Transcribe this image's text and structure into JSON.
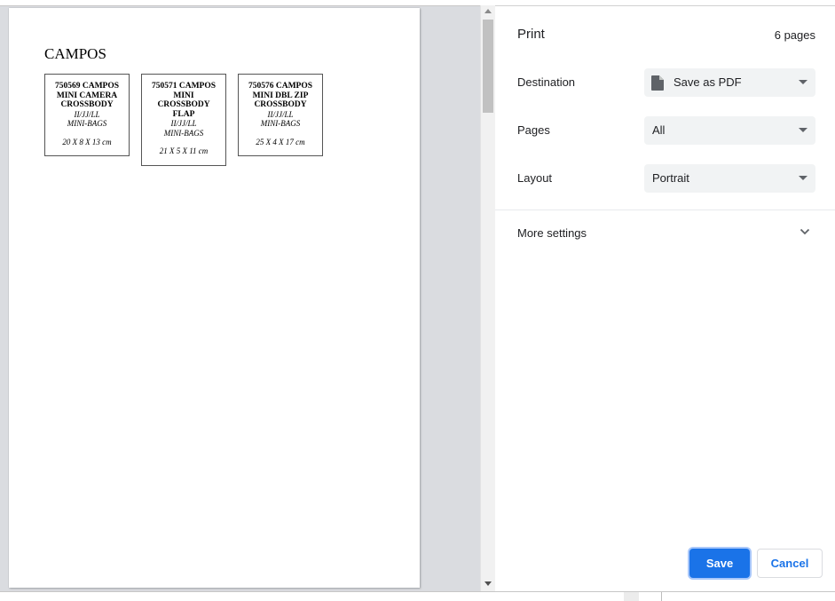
{
  "preview": {
    "heading": "CAMPOS",
    "cards": [
      {
        "title": "750569 CAMPOS\nMINI CAMERA\nCROSSBODY",
        "codes": "II/JJ/LL",
        "category": "MINI-BAGS",
        "dims": "20 X 8 X 13 cm"
      },
      {
        "title": "750571 CAMPOS\nMINI\nCROSSBODY\nFLAP",
        "codes": "II/JJ/LL",
        "category": "MINI-BAGS",
        "dims": "21 X 5 X 11 cm"
      },
      {
        "title": "750576 CAMPOS\nMINI DBL ZIP\nCROSSBODY",
        "codes": "II/JJ/LL",
        "category": "MINI-BAGS",
        "dims": "25 X 4 X 17 cm"
      }
    ]
  },
  "settings": {
    "title": "Print",
    "page_count": "6 pages",
    "destination": {
      "label": "Destination",
      "value": "Save as PDF",
      "icon": "document-icon"
    },
    "pages": {
      "label": "Pages",
      "value": "All"
    },
    "layout": {
      "label": "Layout",
      "value": "Portrait"
    },
    "more_settings": "More settings",
    "save_label": "Save",
    "cancel_label": "Cancel"
  },
  "colors": {
    "accent": "#1a73e8",
    "select_bg": "#f1f3f4",
    "preview_bg": "#dadce0"
  }
}
